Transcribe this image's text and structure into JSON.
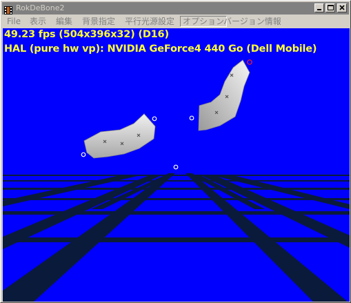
{
  "window": {
    "title": "RokDeBone2",
    "app_icon": "film-strip-icon",
    "controls": [
      "minimize-icon",
      "maximize-icon",
      "close-icon"
    ]
  },
  "menu": {
    "items": [
      {
        "label": "File",
        "state": "disabled"
      },
      {
        "label": "表示",
        "state": "disabled"
      },
      {
        "label": "編集",
        "state": "disabled"
      },
      {
        "label": "背景指定",
        "state": "disabled"
      },
      {
        "label": "平行光源設定",
        "state": "disabled"
      },
      {
        "label": "オプション",
        "state": "highlighted"
      },
      {
        "label": "バージョン情報",
        "state": "disabled"
      }
    ]
  },
  "viewport": {
    "fps_text": "49.23 fps (504x396x32) (D16)",
    "device_text": "HAL (pure hw vp): NVIDIA GeForce4 440 Go (Dell Mobile)",
    "colors": {
      "background": "#0000ff",
      "grid_lines": "#0a1a3a",
      "hud_text": "#ffff33",
      "mesh": "#d8d8d8",
      "joint_marker": "#ffffff",
      "selected_joint_marker": "#ff2020"
    }
  }
}
